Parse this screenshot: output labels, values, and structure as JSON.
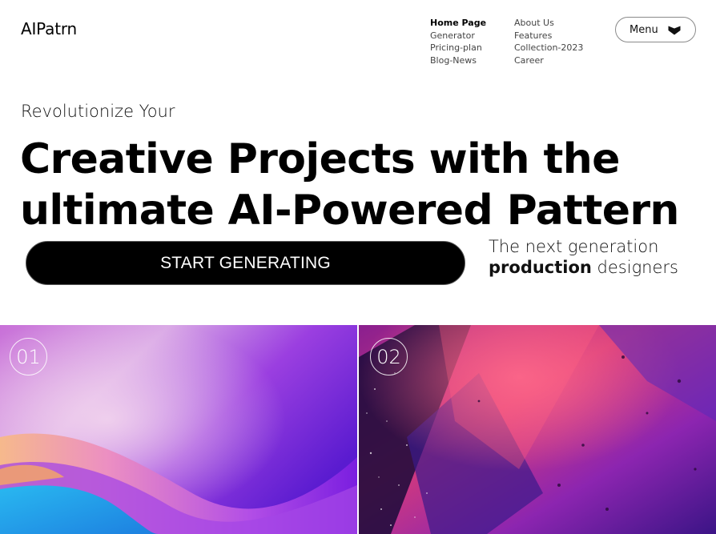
{
  "header": {
    "logo": "AIPatrn",
    "nav_col1": [
      "Home Page",
      "Generator",
      "Pricing-plan",
      "Blog-News"
    ],
    "nav_col2": [
      "About Us",
      "Features",
      "Collection-2023",
      "Career"
    ],
    "active_nav": "Home Page",
    "menu_label": "Menu",
    "menu_icon": "chevron-down-icon"
  },
  "hero": {
    "eyebrow": "Revolutionize Your",
    "headline_line1": "Creative Projects with the",
    "headline_line2": "ultimate AI-Powered Pattern",
    "cta_label": "START GENERATING",
    "tagline_line1": "The next generation",
    "tagline_bold": "production",
    "tagline_rest": " designers"
  },
  "gallery": {
    "tiles": [
      {
        "number": "01"
      },
      {
        "number": "02"
      }
    ]
  },
  "colors": {
    "background": "#ffffff",
    "text": "#000000",
    "cta_bg": "#000000",
    "tile1_accent": "#8a2be2",
    "tile2_accent": "#e8366e"
  }
}
